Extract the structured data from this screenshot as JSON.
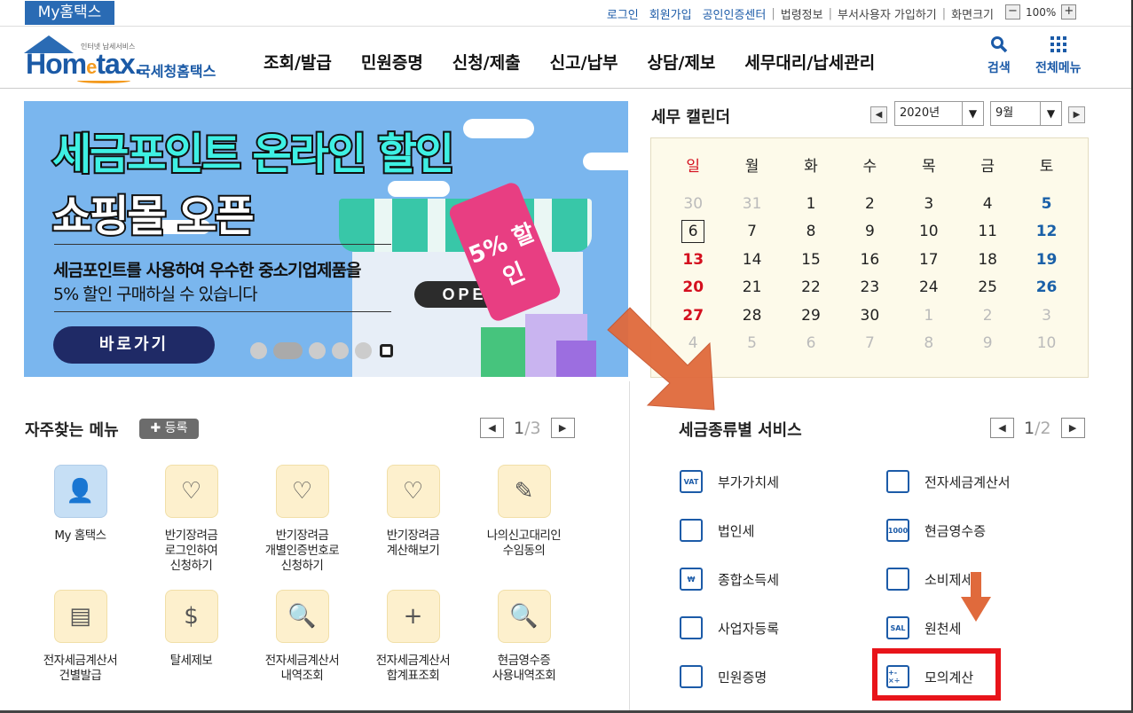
{
  "topbar": {
    "my_hometax": "My홈택스",
    "links_blue": [
      "로그인",
      "회원가입",
      "공인인증센터"
    ],
    "links_gray": [
      "법령정보",
      "부서사용자 가입하기",
      "화면크기"
    ],
    "zoom": "100%"
  },
  "header": {
    "logo_word_a": "Hom",
    "logo_word_e": "e",
    "logo_word_b": "tax.",
    "logo_tag": "인터넷 납세서비스",
    "logo_kr": "국세청홈택스",
    "nav": [
      "조회/발급",
      "민원증명",
      "신청/제출",
      "신고/납부",
      "상담/제보",
      "세무대리/납세관리"
    ],
    "search_label": "검색",
    "allmenu_label": "전체메뉴"
  },
  "banner": {
    "title1": "세금포인트 온라인 할인",
    "title2": "쇼핑몰 오픈",
    "sub1": "세금포인트를 사용하여 우수한 중소기업제품을",
    "sub2": "5% 할인 구매하실 수 있습니다",
    "button": "바로가기",
    "open_sign": "OPEN",
    "tag_text": "5% 할인"
  },
  "calendar": {
    "title": "세무 캘린더",
    "year": "2020년",
    "month": "9월",
    "weekdays": [
      "일",
      "월",
      "화",
      "수",
      "목",
      "금",
      "토"
    ],
    "weeks": [
      [
        "30",
        "31",
        "1",
        "2",
        "3",
        "4",
        "5"
      ],
      [
        "6",
        "7",
        "8",
        "9",
        "10",
        "11",
        "12"
      ],
      [
        "13",
        "14",
        "15",
        "16",
        "17",
        "18",
        "19"
      ],
      [
        "20",
        "21",
        "22",
        "23",
        "24",
        "25",
        "26"
      ],
      [
        "27",
        "28",
        "29",
        "30",
        "1",
        "2",
        "3"
      ],
      [
        "4",
        "5",
        "6",
        "7",
        "8",
        "9",
        "10"
      ]
    ]
  },
  "frequent": {
    "title": "자주찾는 메뉴",
    "register": "등록",
    "page_current": "1",
    "page_total": "/3",
    "items": [
      {
        "label": "My 홈택스",
        "icon": "person-icon"
      },
      {
        "label": "반기장려금\n로그인하여\n신청하기",
        "icon": "heart-pen-icon"
      },
      {
        "label": "반기장려금\n개별인증번호로\n신청하기",
        "icon": "heart-hourglass-icon"
      },
      {
        "label": "반기장려금\n계산해보기",
        "icon": "heart-calc-icon"
      },
      {
        "label": "나의신고대리인\n수임동의",
        "icon": "doc-pen-icon"
      },
      {
        "label": "전자세금계산서\n건별발급",
        "icon": "invoice-icon"
      },
      {
        "label": "탈세제보",
        "icon": "tax-bag-icon"
      },
      {
        "label": "전자세금계산서\n내역조회",
        "icon": "doc-search-icon"
      },
      {
        "label": "전자세금계산서\n합계표조회",
        "icon": "doc-plus-icon"
      },
      {
        "label": "현금영수증\n사용내역조회",
        "icon": "receipt-search-icon"
      }
    ]
  },
  "tax_services": {
    "title": "세금종류별 서비스",
    "page_current": "1",
    "page_total": "/2",
    "items": [
      {
        "label": "부가가치세",
        "icon": "vat-icon",
        "icon_text": "VAT"
      },
      {
        "label": "전자세금계산서",
        "icon": "e-invoice-icon",
        "icon_text": ""
      },
      {
        "label": "법인세",
        "icon": "building-icon",
        "icon_text": ""
      },
      {
        "label": "현금영수증",
        "icon": "cash-receipt-icon",
        "icon_text": "1000"
      },
      {
        "label": "종합소득세",
        "icon": "money-bag-icon",
        "icon_text": "₩"
      },
      {
        "label": "소비제세",
        "icon": "diamond-icon",
        "icon_text": ""
      },
      {
        "label": "사업자등록",
        "icon": "user-icon",
        "icon_text": ""
      },
      {
        "label": "원천세",
        "icon": "salary-icon",
        "icon_text": "SAL"
      },
      {
        "label": "민원증명",
        "icon": "certificate-icon",
        "icon_text": ""
      },
      {
        "label": "모의계산",
        "icon": "calculator-icon",
        "icon_text": "+-×÷"
      }
    ]
  },
  "colors": {
    "brand_blue": "#2a6bb4",
    "highlight_red": "#e8141a",
    "arrow_orange": "#e06a3c"
  }
}
